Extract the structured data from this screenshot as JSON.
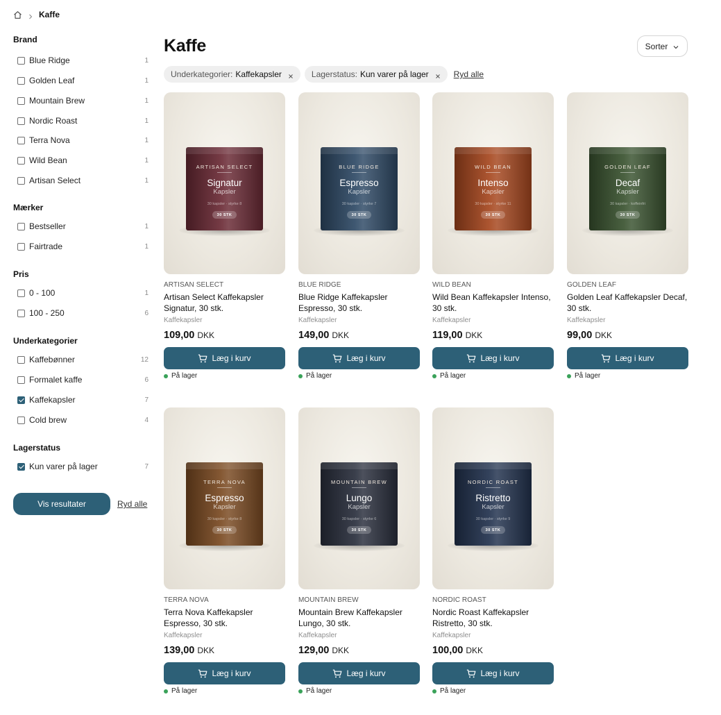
{
  "breadcrumb": {
    "current": "Kaffe"
  },
  "sidebar": {
    "facets": [
      {
        "title": "Brand",
        "options": [
          {
            "label": "Blue Ridge",
            "count": "1",
            "checked": false
          },
          {
            "label": "Golden Leaf",
            "count": "1",
            "checked": false
          },
          {
            "label": "Mountain Brew",
            "count": "1",
            "checked": false
          },
          {
            "label": "Nordic Roast",
            "count": "1",
            "checked": false
          },
          {
            "label": "Terra Nova",
            "count": "1",
            "checked": false
          },
          {
            "label": "Wild Bean",
            "count": "1",
            "checked": false
          },
          {
            "label": "Artisan Select",
            "count": "1",
            "checked": false
          }
        ]
      },
      {
        "title": "Mærker",
        "options": [
          {
            "label": "Bestseller",
            "count": "1",
            "checked": false
          },
          {
            "label": "Fairtrade",
            "count": "1",
            "checked": false
          }
        ]
      },
      {
        "title": "Pris",
        "options": [
          {
            "label": "0 - 100",
            "count": "1",
            "checked": false
          },
          {
            "label": "100 - 250",
            "count": "6",
            "checked": false
          }
        ]
      },
      {
        "title": "Underkategorier",
        "options": [
          {
            "label": "Kaffebønner",
            "count": "12",
            "checked": false
          },
          {
            "label": "Formalet kaffe",
            "count": "6",
            "checked": false
          },
          {
            "label": "Kaffekapsler",
            "count": "7",
            "checked": true
          },
          {
            "label": "Cold brew",
            "count": "4",
            "checked": false
          }
        ]
      },
      {
        "title": "Lagerstatus",
        "options": [
          {
            "label": "Kun varer på lager",
            "count": "7",
            "checked": true
          }
        ]
      }
    ],
    "apply_label": "Vis resultater",
    "clear_label": "Ryd alle"
  },
  "main": {
    "title": "Kaffe",
    "sort_label": "Sorter",
    "chips": [
      {
        "key": "Underkategorier:",
        "value": "Kaffekapsler"
      },
      {
        "key": "Lagerstatus:",
        "value": "Kun varer på lager"
      }
    ],
    "clear_chips_label": "Ryd alle"
  },
  "products": [
    {
      "brand": "ARTISAN SELECT",
      "name": "Artisan Select Kaffekapsler Signatur, 30 stk.",
      "category": "Kaffekapsler",
      "price": "109,00",
      "currency": "DKK",
      "cart_label": "Læg i kurv",
      "stock": "På lager",
      "pack": {
        "brand": "ARTISAN SELECT",
        "flavor": "Signatur",
        "sub": "Kapsler",
        "desc": "30 kapsler · styrke 8",
        "badge": "30 STK",
        "color": "#6a2a35"
      }
    },
    {
      "brand": "BLUE RIDGE",
      "name": "Blue Ridge Kaffekapsler Espresso, 30 stk.",
      "category": "Kaffekapsler",
      "price": "149,00",
      "currency": "DKK",
      "cart_label": "Læg i kurv",
      "stock": "På lager",
      "pack": {
        "brand": "BLUE RIDGE",
        "flavor": "Espresso",
        "sub": "Kapsler",
        "desc": "30 kapsler · styrke 7",
        "badge": "30 STK",
        "color": "#2f4a66"
      }
    },
    {
      "brand": "WILD BEAN",
      "name": "Wild Bean Kaffekapsler Intenso, 30 stk.",
      "category": "Kaffekapsler",
      "price": "119,00",
      "currency": "DKK",
      "cart_label": "Læg i kurv",
      "stock": "På lager",
      "pack": {
        "brand": "WILD BEAN",
        "flavor": "Intenso",
        "sub": "Kapsler",
        "desc": "30 kapsler · styrke 11",
        "badge": "30 STK",
        "color": "#a6471f"
      }
    },
    {
      "brand": "GOLDEN LEAF",
      "name": "Golden Leaf Kaffekapsler Decaf, 30 stk.",
      "category": "Kaffekapsler",
      "price": "99,00",
      "currency": "DKK",
      "cart_label": "Læg i kurv",
      "stock": "På lager",
      "pack": {
        "brand": "GOLDEN LEAF",
        "flavor": "Decaf",
        "sub": "Kapsler",
        "desc": "30 kapsler · koffeinfri",
        "badge": "30 STK",
        "color": "#3a5330"
      }
    },
    {
      "brand": "TERRA NOVA",
      "name": "Terra Nova Kaffekapsler Espresso, 30 stk.",
      "category": "Kaffekapsler",
      "price": "139,00",
      "currency": "DKK",
      "cart_label": "Læg i kurv",
      "stock": "På lager",
      "pack": {
        "brand": "TERRA NOVA",
        "flavor": "Espresso",
        "sub": "Kapsler",
        "desc": "30 kapsler · styrke 8",
        "badge": "30 STK",
        "color": "#7a4a22"
      }
    },
    {
      "brand": "MOUNTAIN BREW",
      "name": "Mountain Brew Kaffekapsler Lungo, 30 stk.",
      "category": "Kaffekapsler",
      "price": "129,00",
      "currency": "DKK",
      "cart_label": "Læg i kurv",
      "stock": "På lager",
      "pack": {
        "brand": "MOUNTAIN BREW",
        "flavor": "Lungo",
        "sub": "Kapsler",
        "desc": "30 kapsler · styrke 6",
        "badge": "30 STK",
        "color": "#2a2f3d"
      }
    },
    {
      "brand": "NORDIC ROAST",
      "name": "Nordic Roast Kaffekapsler Ristretto, 30 stk.",
      "category": "Kaffekapsler",
      "price": "100,00",
      "currency": "DKK",
      "cart_label": "Læg i kurv",
      "stock": "På lager",
      "pack": {
        "brand": "NORDIC ROAST",
        "flavor": "Ristretto",
        "sub": "Kapsler",
        "desc": "30 kapsler · styrke 9",
        "badge": "30 STK",
        "color": "#22324e"
      }
    }
  ],
  "colors": {
    "accent": "#2d6077",
    "in_stock": "#3aa25a"
  },
  "icons": {
    "home": "home-icon",
    "breadcrumb_sep": "chevron-right-icon",
    "sort": "chevron-down-icon",
    "chip_remove": "close-icon",
    "cart": "cart-icon"
  }
}
